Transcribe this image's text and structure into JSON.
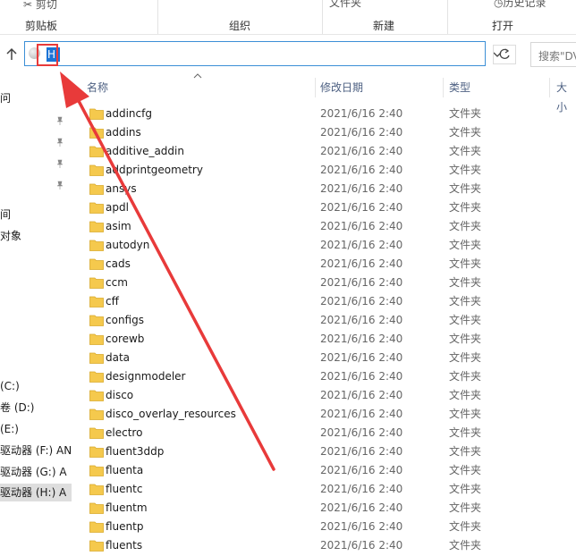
{
  "ribbon": {
    "top_labels": [
      "剪切",
      "文件夹",
      "历史记录"
    ],
    "groups": [
      "剪贴板",
      "组织",
      "新建",
      "打开"
    ]
  },
  "address_bar": {
    "value": "H:"
  },
  "search": {
    "placeholder": "搜索\"DV"
  },
  "navigation": {
    "quick_items": [
      "问",
      "",
      "",
      "",
      "",
      "间",
      "对象"
    ],
    "drives": [
      "(C:)",
      "卷 (D:)",
      "(E:)",
      "驱动器 (F:) AN",
      "驱动器 (G:) A",
      "驱动器 (H:) A"
    ]
  },
  "columns": {
    "name": "名称",
    "date": "修改日期",
    "type": "类型",
    "size": "大小"
  },
  "files": [
    {
      "name": "addincfg",
      "date": "2021/6/16 2:40",
      "type": "文件夹"
    },
    {
      "name": "addins",
      "date": "2021/6/16 2:40",
      "type": "文件夹"
    },
    {
      "name": "additive_addin",
      "date": "2021/6/16 2:40",
      "type": "文件夹"
    },
    {
      "name": "addprintgeometry",
      "date": "2021/6/16 2:40",
      "type": "文件夹"
    },
    {
      "name": "ansys",
      "date": "2021/6/16 2:40",
      "type": "文件夹"
    },
    {
      "name": "apdl",
      "date": "2021/6/16 2:40",
      "type": "文件夹"
    },
    {
      "name": "asim",
      "date": "2021/6/16 2:40",
      "type": "文件夹"
    },
    {
      "name": "autodyn",
      "date": "2021/6/16 2:40",
      "type": "文件夹"
    },
    {
      "name": "cads",
      "date": "2021/6/16 2:40",
      "type": "文件夹"
    },
    {
      "name": "ccm",
      "date": "2021/6/16 2:40",
      "type": "文件夹"
    },
    {
      "name": "cff",
      "date": "2021/6/16 2:40",
      "type": "文件夹"
    },
    {
      "name": "configs",
      "date": "2021/6/16 2:40",
      "type": "文件夹"
    },
    {
      "name": "corewb",
      "date": "2021/6/16 2:40",
      "type": "文件夹"
    },
    {
      "name": "data",
      "date": "2021/6/16 2:40",
      "type": "文件夹"
    },
    {
      "name": "designmodeler",
      "date": "2021/6/16 2:40",
      "type": "文件夹"
    },
    {
      "name": "disco",
      "date": "2021/6/16 2:40",
      "type": "文件夹"
    },
    {
      "name": "disco_overlay_resources",
      "date": "2021/6/16 2:40",
      "type": "文件夹"
    },
    {
      "name": "electro",
      "date": "2021/6/16 2:40",
      "type": "文件夹"
    },
    {
      "name": "fluent3ddp",
      "date": "2021/6/16 2:40",
      "type": "文件夹"
    },
    {
      "name": "fluenta",
      "date": "2021/6/16 2:40",
      "type": "文件夹"
    },
    {
      "name": "fluentc",
      "date": "2021/6/16 2:40",
      "type": "文件夹"
    },
    {
      "name": "fluentm",
      "date": "2021/6/16 2:40",
      "type": "文件夹"
    },
    {
      "name": "fluentp",
      "date": "2021/6/16 2:40",
      "type": "文件夹"
    },
    {
      "name": "fluents",
      "date": "2021/6/16 2:40",
      "type": "文件夹"
    }
  ],
  "colors": {
    "accent": "#3c8fd6",
    "selection": "#1a73d6",
    "annotation": "#e83a3a",
    "folder": "#f5c94d"
  }
}
